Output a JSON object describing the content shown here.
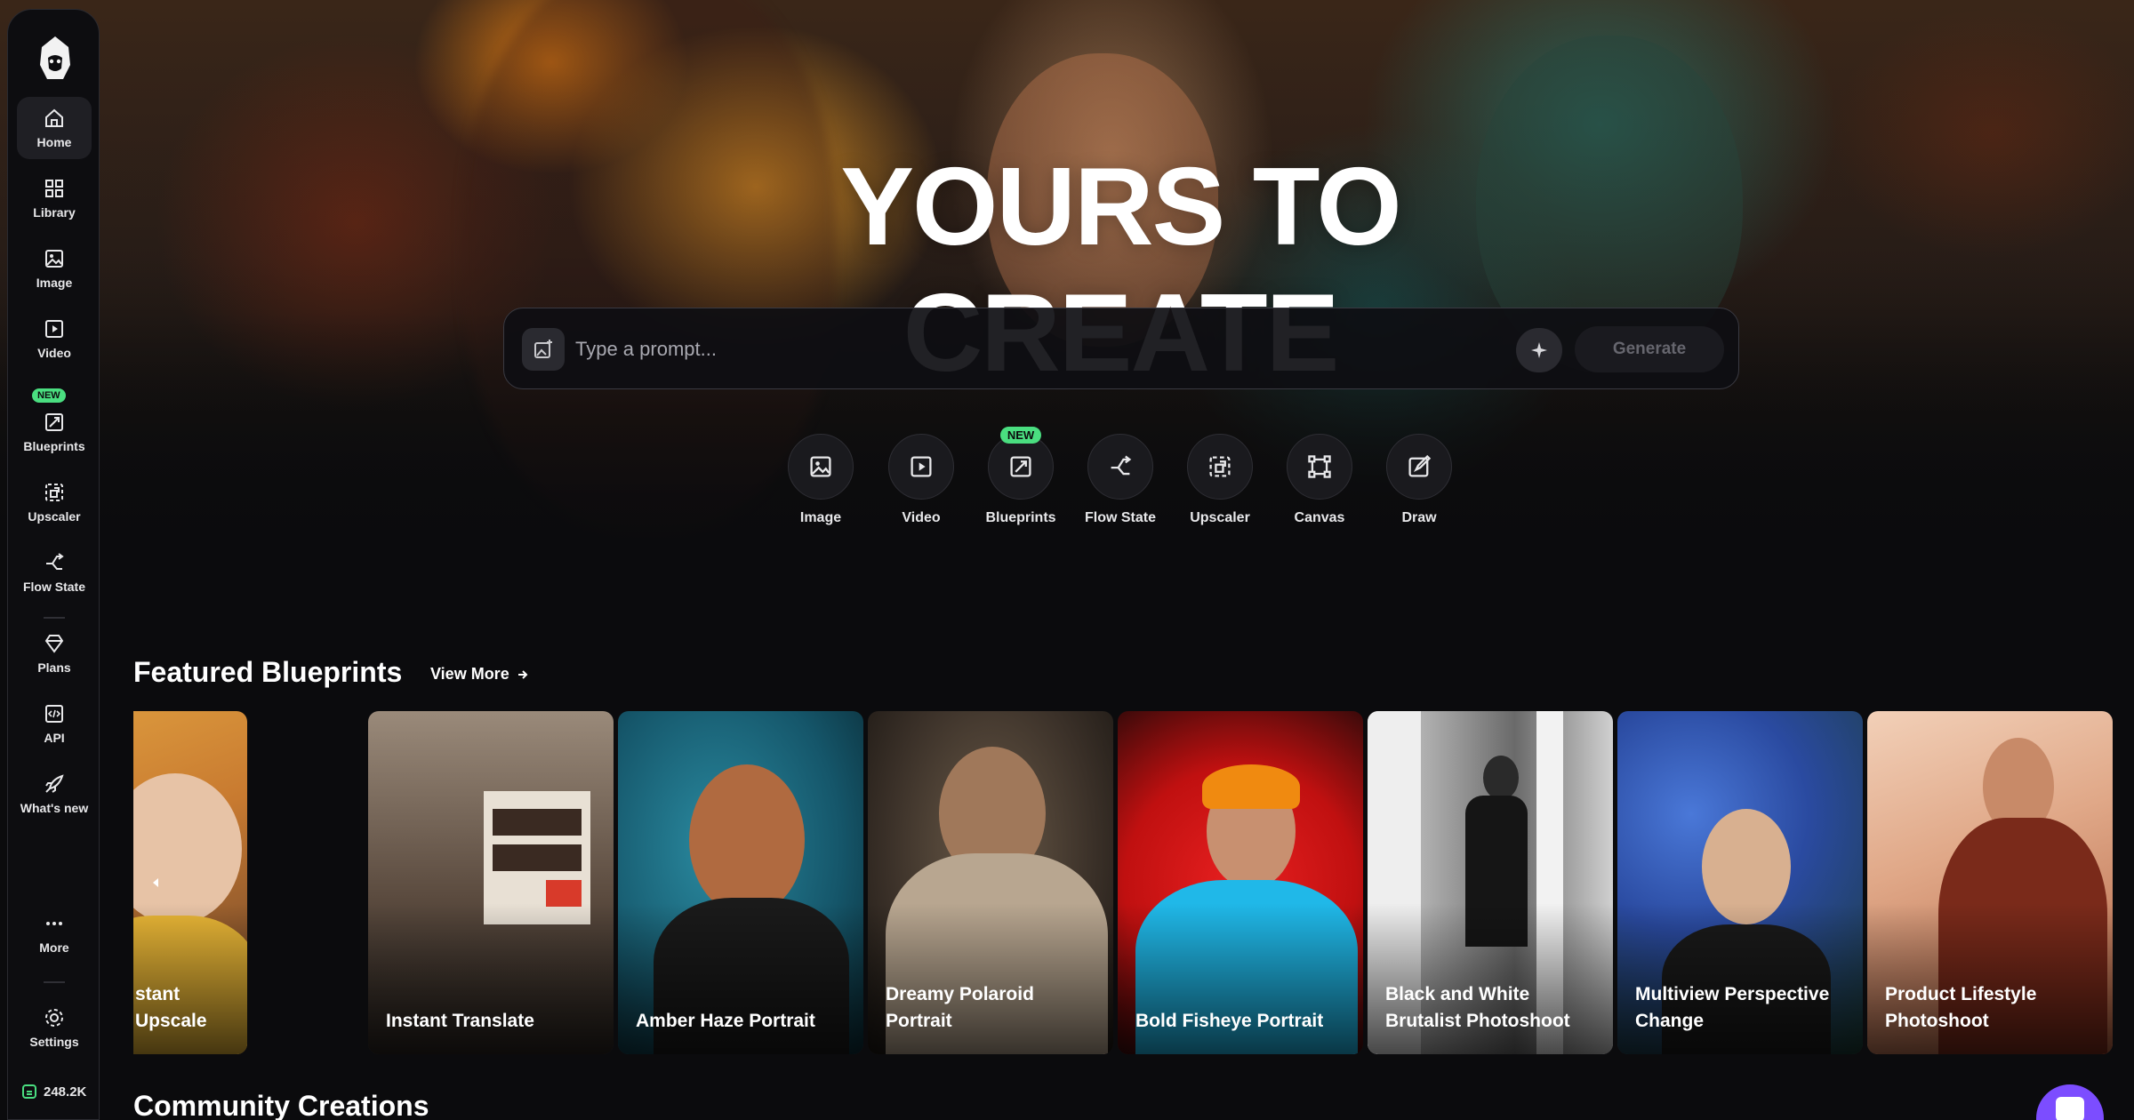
{
  "sidebar": {
    "logo_icon": "wizard-logo-icon",
    "items": [
      {
        "label": "Home",
        "icon": "home-icon",
        "active": true
      },
      {
        "label": "Library",
        "icon": "grid-icon"
      },
      {
        "label": "Image",
        "icon": "image-icon"
      },
      {
        "label": "Video",
        "icon": "play-icon"
      },
      {
        "label": "Blueprints",
        "icon": "blueprint-icon",
        "badge": "NEW"
      },
      {
        "label": "Upscaler",
        "icon": "upscale-icon"
      },
      {
        "label": "Flow State",
        "icon": "flow-icon"
      },
      {
        "label": "Plans",
        "icon": "diamond-icon"
      },
      {
        "label": "API",
        "icon": "code-icon"
      },
      {
        "label": "What's new",
        "icon": "rocket-icon"
      },
      {
        "label": "More",
        "icon": "dots-icon"
      },
      {
        "label": "Settings",
        "icon": "gear-icon"
      }
    ],
    "credits": "248.2K"
  },
  "hero": {
    "title": "YOURS TO CREATE",
    "prompt_placeholder": "Type a prompt...",
    "generate_label": "Generate"
  },
  "tools": [
    {
      "label": "Image",
      "icon": "image-icon"
    },
    {
      "label": "Video",
      "icon": "play-icon"
    },
    {
      "label": "Blueprints",
      "icon": "blueprint-icon",
      "badge": "NEW"
    },
    {
      "label": "Flow State",
      "icon": "flow-icon"
    },
    {
      "label": "Upscaler",
      "icon": "upscale-icon"
    },
    {
      "label": "Canvas",
      "icon": "canvas-icon"
    },
    {
      "label": "Draw",
      "icon": "draw-icon"
    }
  ],
  "featured": {
    "title": "Featured Blueprints",
    "view_more": "View More",
    "cards": [
      {
        "title": "stant Upscale",
        "bg": "#d9a23c"
      },
      {
        "title": "Instant Translate",
        "bg": "#6b5a4c"
      },
      {
        "title": "Amber Haze Portrait",
        "bg": "#1f6f80"
      },
      {
        "title": "Dreamy Polaroid Portrait",
        "bg": "#5a4a3a"
      },
      {
        "title": "Bold Fisheye Portrait",
        "bg": "#c81818"
      },
      {
        "title": "Black and White Brutalist Photoshoot",
        "bg": "#8a8a8a"
      },
      {
        "title": "Multiview Perspective Change",
        "bg": "#2b4aa8"
      },
      {
        "title": "Product Lifestyle Photoshoot",
        "bg": "#d8a58a"
      }
    ]
  },
  "community": {
    "title": "Community Creations"
  },
  "colors": {
    "accent_new": "#4ade80",
    "chat_fab": "#7c4dff"
  }
}
